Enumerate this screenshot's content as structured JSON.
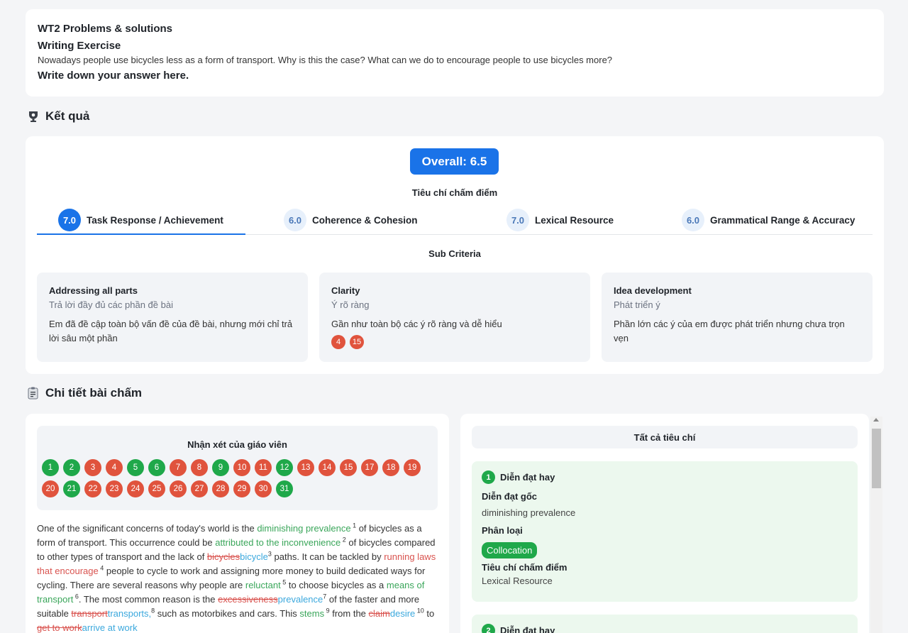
{
  "exercise": {
    "title": "WT2 Problems & solutions",
    "subtitle": "Writing Exercise",
    "prompt": "Nowadays people use bicycles less as a form of transport. Why is this the case? What can we do to encourage people to use bicycles more?",
    "instruction": "Write down your answer here."
  },
  "results": {
    "heading": "Kết quả",
    "overall": "Overall: 6.5",
    "criteria_title": "Tiêu chí chấm điểm",
    "tabs": [
      {
        "score": "7.0",
        "label": "Task Response / Achievement"
      },
      {
        "score": "6.0",
        "label": "Coherence & Cohesion"
      },
      {
        "score": "7.0",
        "label": "Lexical Resource"
      },
      {
        "score": "6.0",
        "label": "Grammatical Range & Accuracy"
      }
    ],
    "subcriteria_title": "Sub Criteria",
    "subcriteria": [
      {
        "name": "Addressing all parts",
        "vn": "Trả lời đầy đủ các phần đề bài",
        "desc": "Em đã đề cập toàn bộ vấn đề của đề bài, nhưng mới chỉ trả lời sâu một phần"
      },
      {
        "name": "Clarity",
        "vn": "Ý rõ ràng",
        "desc": "Gần như toàn bộ các ý rõ ràng và dễ hiểu",
        "refs": [
          "4",
          "15"
        ]
      },
      {
        "name": "Idea development",
        "vn": "Phát triển ý",
        "desc": "Phần lớn các ý của em được phát triển nhưng chưa trọn vẹn"
      }
    ]
  },
  "details": {
    "heading": "Chi tiết bài chấm",
    "teacher_title": "Nhận xét của giáo viên",
    "feedback_numbers": [
      {
        "n": "1",
        "status": "green"
      },
      {
        "n": "2",
        "status": "green"
      },
      {
        "n": "3",
        "status": "red"
      },
      {
        "n": "4",
        "status": "red"
      },
      {
        "n": "5",
        "status": "green"
      },
      {
        "n": "6",
        "status": "green"
      },
      {
        "n": "7",
        "status": "red"
      },
      {
        "n": "8",
        "status": "red"
      },
      {
        "n": "9",
        "status": "green"
      },
      {
        "n": "10",
        "status": "red"
      },
      {
        "n": "11",
        "status": "red"
      },
      {
        "n": "12",
        "status": "green"
      },
      {
        "n": "13",
        "status": "red"
      },
      {
        "n": "14",
        "status": "red"
      },
      {
        "n": "15",
        "status": "red"
      },
      {
        "n": "17",
        "status": "red"
      },
      {
        "n": "18",
        "status": "red"
      },
      {
        "n": "19",
        "status": "red"
      },
      {
        "n": "20",
        "status": "red"
      },
      {
        "n": "21",
        "status": "green"
      },
      {
        "n": "22",
        "status": "red"
      },
      {
        "n": "23",
        "status": "red"
      },
      {
        "n": "24",
        "status": "red"
      },
      {
        "n": "25",
        "status": "red"
      },
      {
        "n": "26",
        "status": "red"
      },
      {
        "n": "27",
        "status": "red"
      },
      {
        "n": "28",
        "status": "red"
      },
      {
        "n": "29",
        "status": "red"
      },
      {
        "n": "30",
        "status": "red"
      },
      {
        "n": "31",
        "status": "green"
      }
    ],
    "essay_segments": [
      {
        "t": "One of the significant concerns of today's world is the ",
        "c": ""
      },
      {
        "t": "diminishing prevalence",
        "c": "g"
      },
      {
        "sup": " 1"
      },
      {
        "t": " of bicycles as a form of transport. This occurrence could be ",
        "c": ""
      },
      {
        "t": "attributed to the inconvenience",
        "c": "g"
      },
      {
        "sup": " 2"
      },
      {
        "t": " of bicycles compared to other types of transport and the lack of ",
        "c": ""
      },
      {
        "t": "bicycles",
        "c": "s"
      },
      {
        "t": "bicycle",
        "c": "b"
      },
      {
        "sup": "3"
      },
      {
        "t": " paths. It can be tackled by ",
        "c": ""
      },
      {
        "t": "running laws that encourage",
        "c": "r"
      },
      {
        "sup": " 4"
      },
      {
        "t": " people to cycle to work and assigning more money to build dedicated ways for cycling. There are several reasons why people are ",
        "c": ""
      },
      {
        "t": "reluctant",
        "c": "g"
      },
      {
        "sup": " 5"
      },
      {
        "t": " to choose bicycles as a ",
        "c": ""
      },
      {
        "t": "means of transport",
        "c": "g"
      },
      {
        "sup": " 6"
      },
      {
        "t": ". The most common reason is the ",
        "c": ""
      },
      {
        "t": "excessiveness",
        "c": "s"
      },
      {
        "t": "prevalence",
        "c": "b"
      },
      {
        "sup": "7"
      },
      {
        "t": " of the faster and more suitable ",
        "c": ""
      },
      {
        "t": "transport",
        "c": "s"
      },
      {
        "t": "transports,",
        "c": "b"
      },
      {
        "sup": "8"
      },
      {
        "t": " such as motorbikes and cars. This ",
        "c": ""
      },
      {
        "t": "stems",
        "c": "g"
      },
      {
        "sup": " 9"
      },
      {
        "t": " from the ",
        "c": ""
      },
      {
        "t": "claim",
        "c": "s"
      },
      {
        "t": "desire",
        "c": "b"
      },
      {
        "sup": " 10"
      },
      {
        "t": " to ",
        "c": ""
      },
      {
        "t": "get to work",
        "c": "s"
      },
      {
        "t": "arrive at work",
        "c": "b"
      }
    ],
    "all_criteria": "Tất cả tiêu chí",
    "criteria_items": [
      {
        "num": "1",
        "title": "Diễn đạt hay",
        "original_label": "Diễn đạt gốc",
        "original": "diminishing prevalence",
        "type_label": "Phân loại",
        "type": "Collocation",
        "criterion_label": "Tiêu chí chấm điểm",
        "criterion": "Lexical Resource"
      },
      {
        "num": "2",
        "title": "Diễn đạt hay"
      }
    ]
  },
  "colors": {
    "accent": "#1a73e8",
    "good": "#1fa84a",
    "bad": "#e0533d",
    "highlight_good": "#3aa65a",
    "correction": "#3ba8dd"
  }
}
